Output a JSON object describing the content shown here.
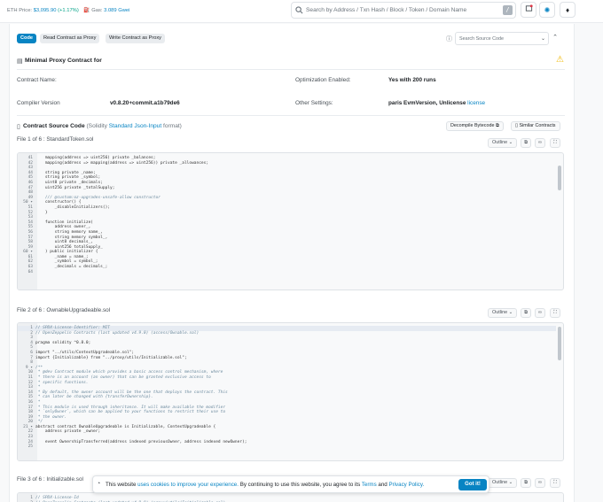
{
  "header": {
    "eth_price_label": "ETH Price:",
    "eth_price_value": "$3,095.90",
    "eth_price_change": "(+1.17%)",
    "gas_label": "Gas:",
    "gas_value": "3.089 Gwei",
    "search_placeholder": "Search by Address / Txn Hash / Block / Token / Domain Name",
    "search_shortcut": "/"
  },
  "tabs": [
    {
      "label": "Code",
      "active": true
    },
    {
      "label": "Read Contract as Proxy",
      "active": false
    },
    {
      "label": "Write Contract as Proxy",
      "active": false
    }
  ],
  "source_search_placeholder": "Search Source Code",
  "proxy_title": "Minimal Proxy Contract for",
  "info": {
    "contract_name_label": "Contract Name:",
    "compiler_label": "Compiler Version",
    "compiler_value": "v0.8.20+commit.a1b79de6",
    "optimization_label": "Optimization Enabled:",
    "optimization_value": "Yes with 200 runs",
    "other_label": "Other Settings:",
    "other_value": "paris EvmVersion, Unlicense",
    "other_link": "license"
  },
  "source_section": {
    "title": "Contract Source Code",
    "paren_open": "(Solidity",
    "link": "Standard Json-Input",
    "paren_close": "format)",
    "decompile_label": "Decompile Bytecode",
    "similar_label": "Similar Contracts"
  },
  "outline_label": "Outline",
  "files": [
    {
      "title": "File 1 of 6 : StandardToken.sol",
      "lines": [
        {
          "n": "41",
          "t": "    mapping(address => uint256) private _balances;"
        },
        {
          "n": "42",
          "t": "    mapping(address => mapping(address => uint256)) private _allowances;"
        },
        {
          "n": "43",
          "t": ""
        },
        {
          "n": "44",
          "t": "    string private _name;"
        },
        {
          "n": "45",
          "t": "    string private _symbol;"
        },
        {
          "n": "46",
          "t": "    uint8 private _decimals;"
        },
        {
          "n": "47",
          "t": "    uint256 private _totalSupply;"
        },
        {
          "n": "48",
          "t": ""
        },
        {
          "n": "49",
          "t": "    /// @custom:oz-upgrades-unsafe-allow constructor"
        },
        {
          "n": "50 ▾",
          "t": "    constructor() {"
        },
        {
          "n": "51",
          "t": "        _disableInitializers();"
        },
        {
          "n": "52",
          "t": "    }"
        },
        {
          "n": "53",
          "t": ""
        },
        {
          "n": "54",
          "t": "    function initialize("
        },
        {
          "n": "55",
          "t": "        address owner_,"
        },
        {
          "n": "56",
          "t": "        string memory name_,"
        },
        {
          "n": "57",
          "t": "        string memory symbol_,"
        },
        {
          "n": "58",
          "t": "        uint8 decimals_,"
        },
        {
          "n": "59",
          "t": "        uint256 totalSupply_"
        },
        {
          "n": "60 ▾",
          "t": "    ) public initializer {"
        },
        {
          "n": "61",
          "t": "        _name = name_;"
        },
        {
          "n": "62",
          "t": "        _symbol = symbol_;"
        },
        {
          "n": "63",
          "t": "        _decimals = decimals_;"
        },
        {
          "n": "64",
          "t": ""
        }
      ]
    },
    {
      "title": "File 2 of 6 : OwnableUpgradeable.sol",
      "lines": [
        {
          "n": "1",
          "t": "// SPDX-License-Identifier: MIT"
        },
        {
          "n": "2",
          "t": "// OpenZeppelin Contracts (last updated v4.9.0) (access/Ownable.sol)"
        },
        {
          "n": "3",
          "t": ""
        },
        {
          "n": "4",
          "t": "pragma solidity ^0.8.0;"
        },
        {
          "n": "5",
          "t": ""
        },
        {
          "n": "6",
          "t": "import \"../utils/ContextUpgradeable.sol\";"
        },
        {
          "n": "7",
          "t": "import {Initializable} from \"../proxy/utils/Initializable.sol\";"
        },
        {
          "n": "8",
          "t": ""
        },
        {
          "n": "9 ▾",
          "t": "/**"
        },
        {
          "n": "10",
          "t": " * @dev Contract module which provides a basic access control mechanism, where"
        },
        {
          "n": "11",
          "t": " * there is an account (an owner) that can be granted exclusive access to"
        },
        {
          "n": "12",
          "t": " * specific functions."
        },
        {
          "n": "13",
          "t": " *"
        },
        {
          "n": "14",
          "t": " * By default, the owner account will be the one that deploys the contract. This"
        },
        {
          "n": "15",
          "t": " * can later be changed with {transferOwnership}."
        },
        {
          "n": "16",
          "t": " *"
        },
        {
          "n": "17",
          "t": " * This module is used through inheritance. It will make available the modifier"
        },
        {
          "n": "18",
          "t": " * `onlyOwner`, which can be applied to your functions to restrict their use to"
        },
        {
          "n": "19",
          "t": " * the owner."
        },
        {
          "n": "20",
          "t": " */"
        },
        {
          "n": "21 ▾",
          "t": "abstract contract OwnableUpgradeable is Initializable, ContextUpgradeable {"
        },
        {
          "n": "22",
          "t": "    address private _owner;"
        },
        {
          "n": "23",
          "t": ""
        },
        {
          "n": "24",
          "t": "    event OwnershipTransferred(address indexed previousOwner, address indexed newOwner);"
        },
        {
          "n": "25",
          "t": ""
        }
      ]
    },
    {
      "title": "File 3 of 6 : Initializable.sol",
      "lines": [
        {
          "n": "1",
          "t": "// SPDX-License-Id"
        },
        {
          "n": "2",
          "t": "// OpenZeppelin Contracts (last updated v4.9.0) (proxy/utils/Initializable.sol)"
        }
      ]
    }
  ],
  "cookie": {
    "prefix": "This website",
    "link1": "uses cookies to improve your experience.",
    "middle": "By continuing to use this website, you agree to its",
    "link2": "Terms",
    "and": "and",
    "link3": "Privacy Policy.",
    "button": "Got it!"
  },
  "colors": {
    "accent": "#0784c3",
    "positive": "#00a186",
    "warning": "#f0b90b"
  }
}
